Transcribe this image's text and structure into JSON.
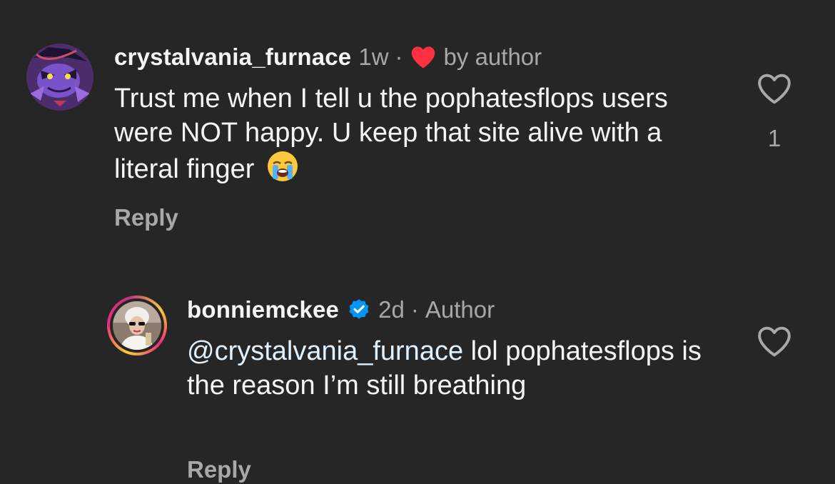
{
  "comments": [
    {
      "username": "crystalvania_furnace",
      "time": "1w",
      "separator": "·",
      "liked_by_author_label": "by author",
      "text": "Trust me when I tell u the pophatesflops users were NOT happy. U keep that site alive with a literal finger",
      "emoji": "loudly-crying-face",
      "reply_label": "Reply",
      "like_count": "1",
      "like_icon": "heart-outline-icon",
      "author_heart_color": "#ff3040"
    },
    {
      "username": "bonniemckee",
      "verified": true,
      "verified_color": "#0095f6",
      "time": "2d",
      "separator": "·",
      "author_label": "Author",
      "mention": "@crystalvania_furnace",
      "text": " lol pophatesflops is the reason I’m still breathing",
      "reply_label": "Reply",
      "like_icon": "heart-outline-icon"
    }
  ],
  "colors": {
    "background": "#262626",
    "text_primary": "#f5f5f5",
    "text_secondary": "#a8a8a8",
    "mention": "#e0f1ff"
  }
}
